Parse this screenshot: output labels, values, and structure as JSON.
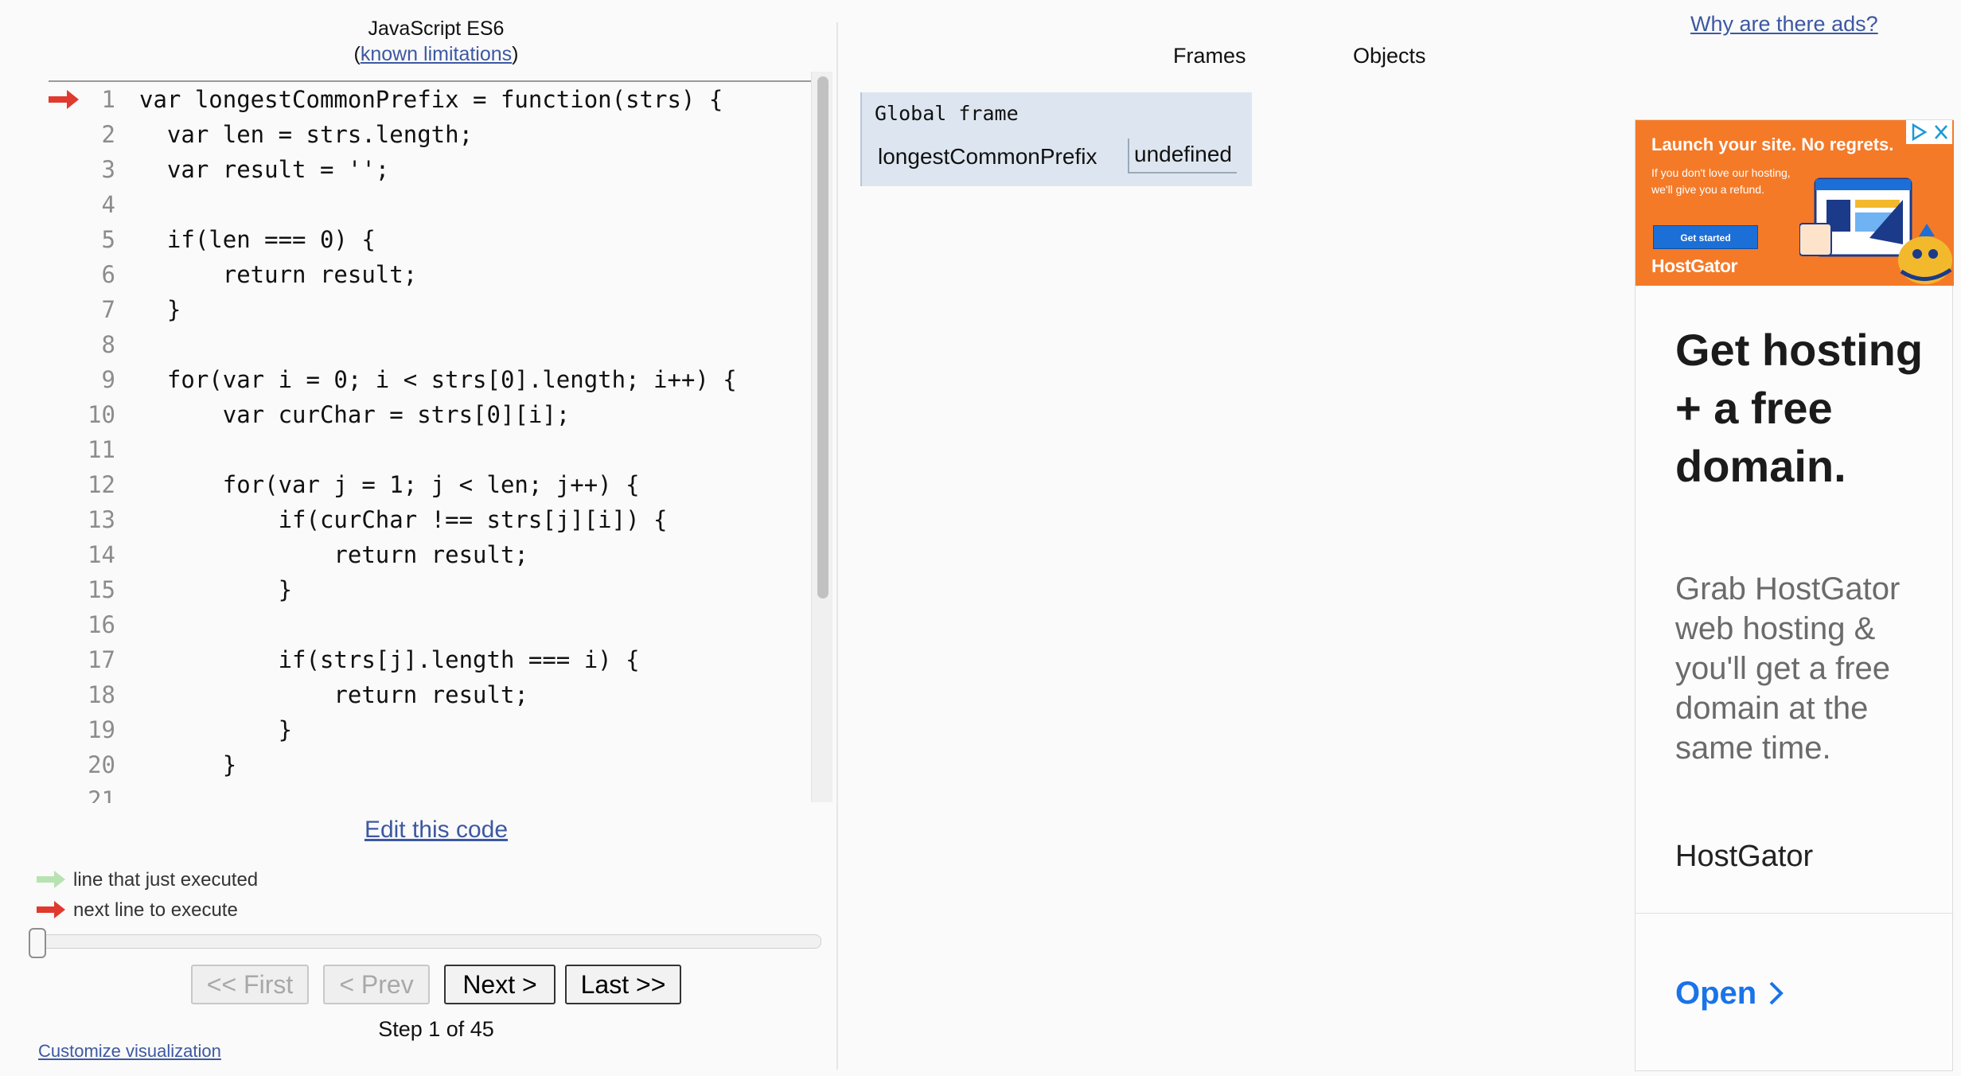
{
  "header": {
    "language": "JavaScript ES6",
    "limitations_open": "(",
    "limitations_link": "known limitations",
    "limitations_close": ")"
  },
  "code": {
    "current_line": 1,
    "lines": [
      {
        "n": "1",
        "text": "var longestCommonPrefix = function(strs) {"
      },
      {
        "n": "2",
        "text": "  var len = strs.length;"
      },
      {
        "n": "3",
        "text": "  var result = '';"
      },
      {
        "n": "4",
        "text": ""
      },
      {
        "n": "5",
        "text": "  if(len === 0) {"
      },
      {
        "n": "6",
        "text": "      return result;"
      },
      {
        "n": "7",
        "text": "  }"
      },
      {
        "n": "8",
        "text": ""
      },
      {
        "n": "9",
        "text": "  for(var i = 0; i < strs[0].length; i++) {"
      },
      {
        "n": "10",
        "text": "      var curChar = strs[0][i];"
      },
      {
        "n": "11",
        "text": ""
      },
      {
        "n": "12",
        "text": "      for(var j = 1; j < len; j++) {"
      },
      {
        "n": "13",
        "text": "          if(curChar !== strs[j][i]) {"
      },
      {
        "n": "14",
        "text": "              return result;"
      },
      {
        "n": "15",
        "text": "          }"
      },
      {
        "n": "16",
        "text": ""
      },
      {
        "n": "17",
        "text": "          if(strs[j].length === i) {"
      },
      {
        "n": "18",
        "text": "              return result;"
      },
      {
        "n": "19",
        "text": "          }"
      },
      {
        "n": "20",
        "text": "      }"
      },
      {
        "n": "21",
        "text": ""
      }
    ]
  },
  "edit_link": "Edit this code",
  "legend": {
    "executed": "line that just executed",
    "next": "next line to execute",
    "executed_color": "#b7e3b0",
    "next_color": "#e03a2f"
  },
  "navigation": {
    "first": "<< First",
    "prev": "< Prev",
    "next": "Next >",
    "last": "Last >>",
    "step_text": "Step 1 of 45",
    "current_step": 1,
    "total_steps": 45
  },
  "customize_link": "Customize visualization",
  "viz": {
    "frames_heading": "Frames",
    "objects_heading": "Objects",
    "global_frame": {
      "title": "Global frame",
      "variable": "longestCommonPrefix",
      "value": "undefined"
    }
  },
  "ad": {
    "why_link": "Why are there ads?",
    "banner_headline": "Launch your site. No regrets.",
    "banner_sub": "If you don't love our hosting, we'll give you a refund.",
    "banner_cta": "Get started",
    "banner_brand": "HostGator",
    "headline": "Get hosting + a free domain.",
    "body": "Grab HostGator web hosting & you'll get a free domain at the same time.",
    "advertiser": "HostGator",
    "cta": "Open",
    "accent_color": "#1a73e8",
    "banner_color": "#f47a28"
  }
}
